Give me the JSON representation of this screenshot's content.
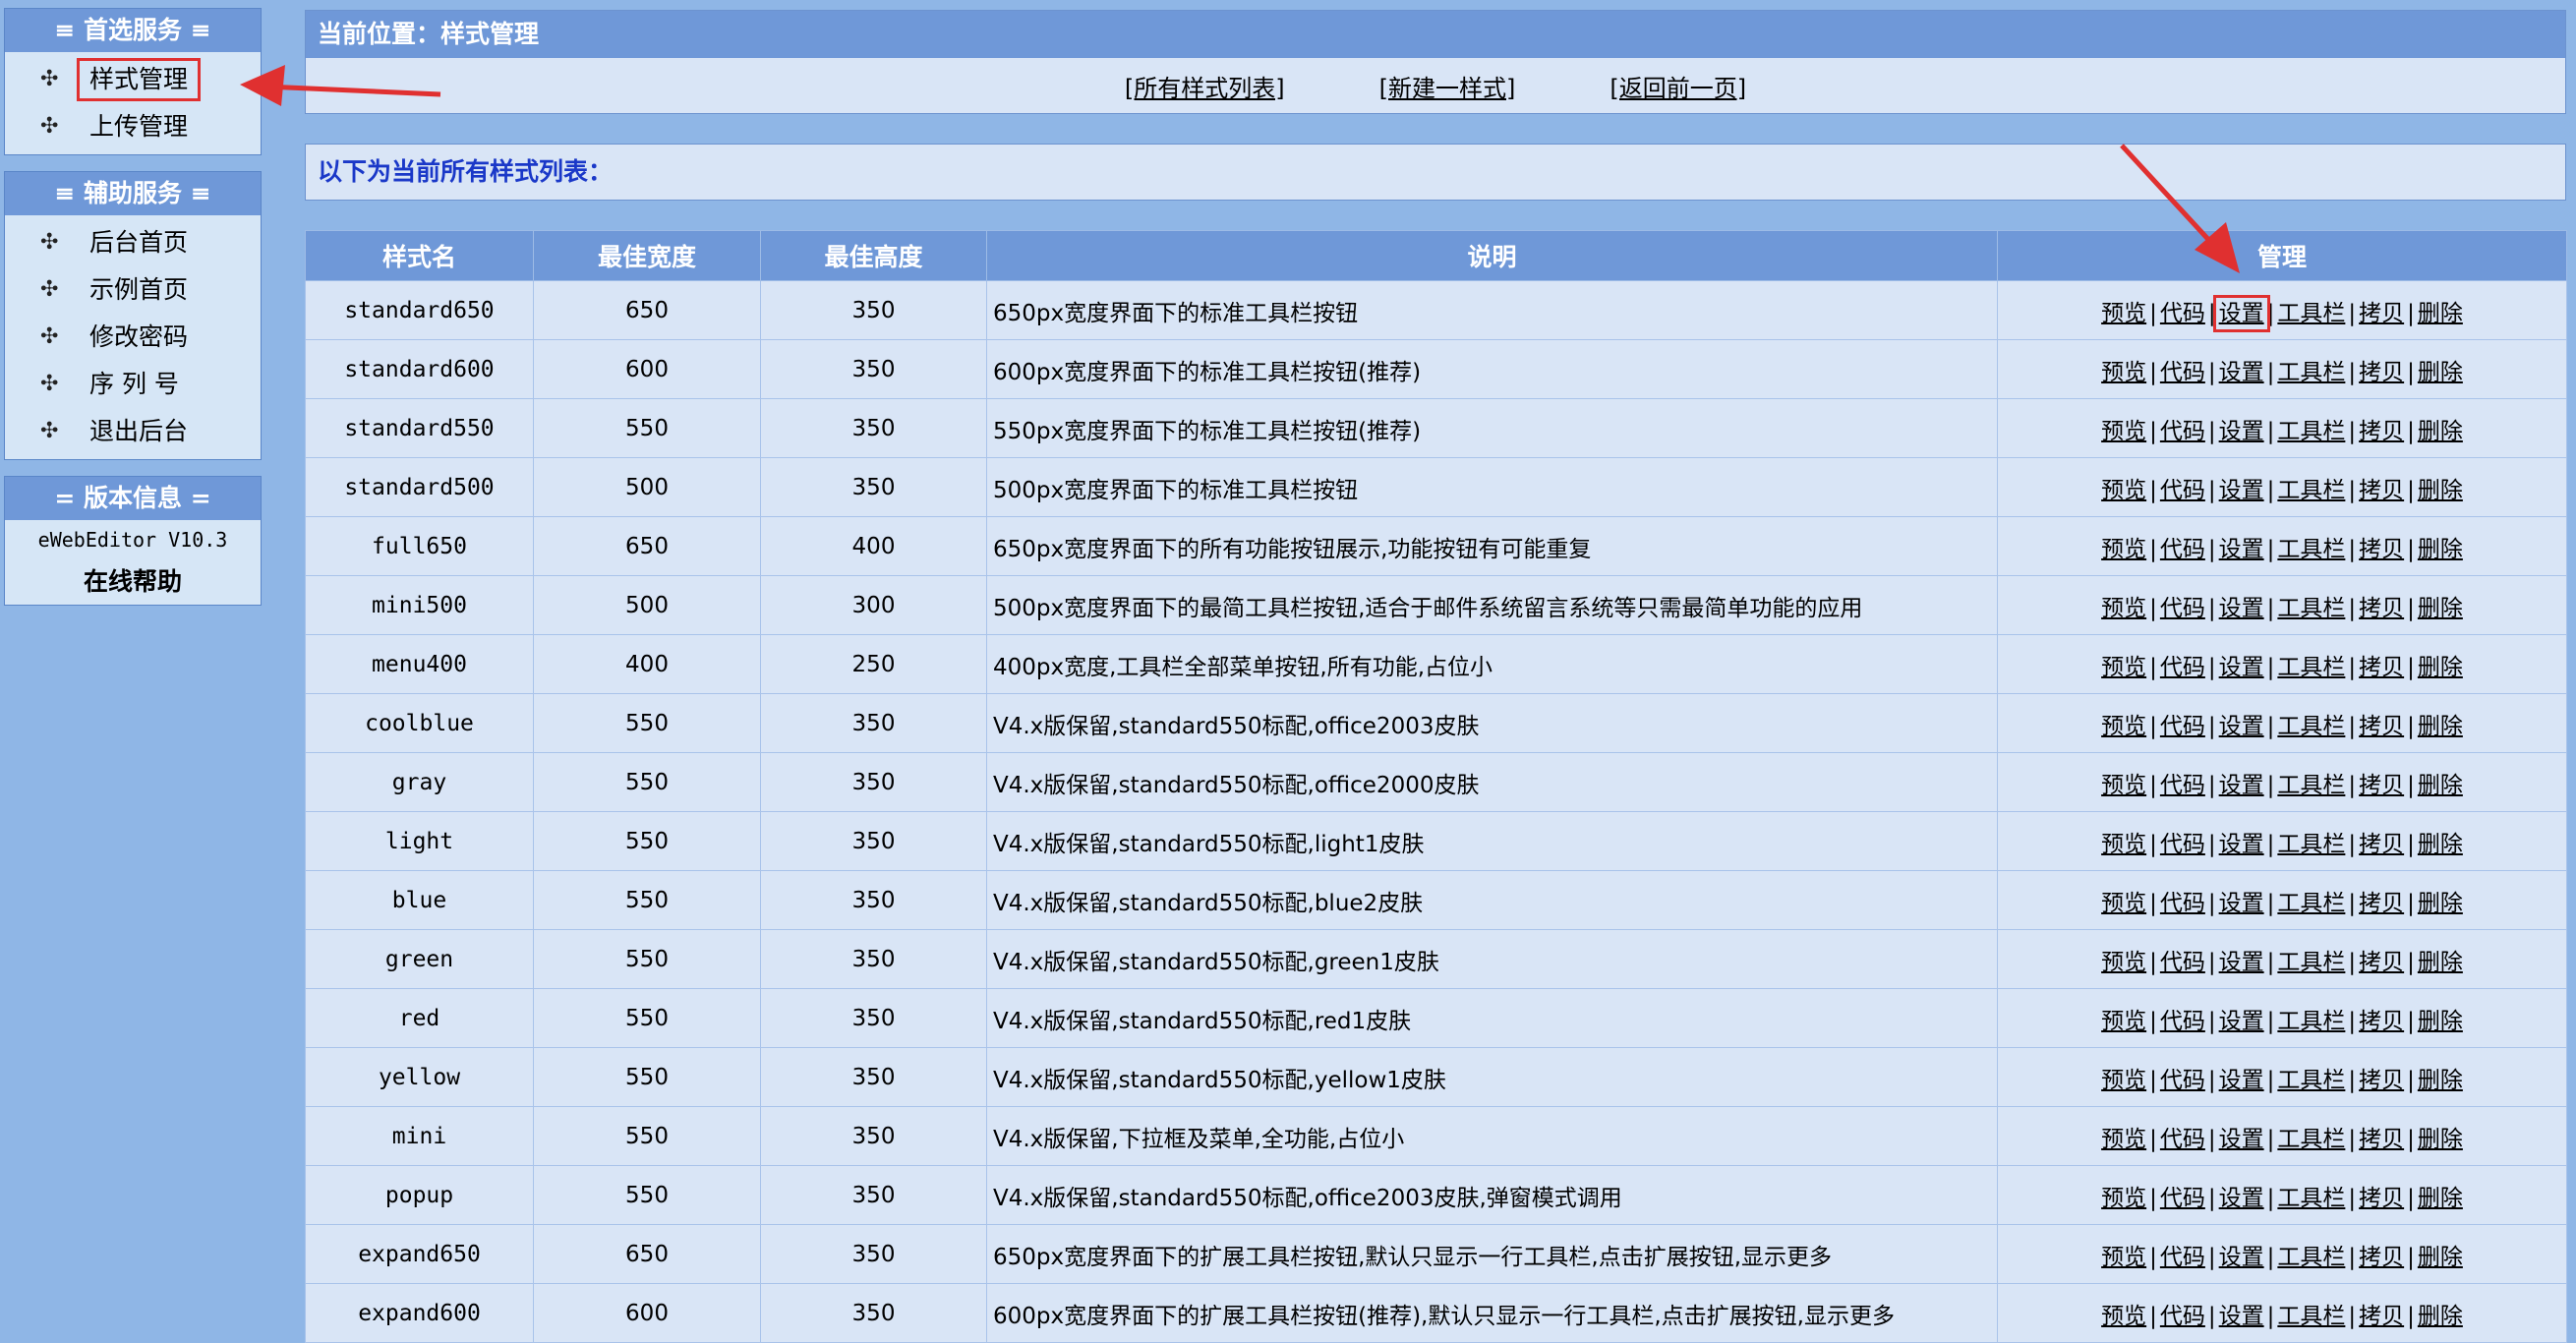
{
  "sidebar": {
    "box1": {
      "title": "≡ 首选服务 ≡",
      "items": [
        {
          "label": "样式管理"
        },
        {
          "label": "上传管理"
        }
      ]
    },
    "box2": {
      "title": "≡ 辅助服务 ≡",
      "items": [
        {
          "label": "后台首页"
        },
        {
          "label": "示例首页"
        },
        {
          "label": "修改密码"
        },
        {
          "label": "序 列 号"
        },
        {
          "label": "退出后台"
        }
      ]
    },
    "box3": {
      "title": "= 版本信息 =",
      "version": "eWebEditor V10.3",
      "help": "在线帮助"
    },
    "bullet": "✣"
  },
  "main": {
    "location": "当前位置：样式管理",
    "toolbar": {
      "all_styles": "[所有样式列表]",
      "new_style": "[新建一样式]",
      "back": "[返回前一页]"
    },
    "list_heading": "以下为当前所有样式列表："
  },
  "table": {
    "headers": [
      "样式名",
      "最佳宽度",
      "最佳高度",
      "说明",
      "管理"
    ],
    "ops": [
      "预览",
      "代码",
      "设置",
      "工具栏",
      "拷贝",
      "删除"
    ],
    "rows": [
      {
        "name": "standard650",
        "width": "650",
        "height": "350",
        "desc": "650px宽度界面下的标准工具栏按钮"
      },
      {
        "name": "standard600",
        "width": "600",
        "height": "350",
        "desc": "600px宽度界面下的标准工具栏按钮(推荐)"
      },
      {
        "name": "standard550",
        "width": "550",
        "height": "350",
        "desc": "550px宽度界面下的标准工具栏按钮(推荐)"
      },
      {
        "name": "standard500",
        "width": "500",
        "height": "350",
        "desc": "500px宽度界面下的标准工具栏按钮"
      },
      {
        "name": "full650",
        "width": "650",
        "height": "400",
        "desc": "650px宽度界面下的所有功能按钮展示,功能按钮有可能重复"
      },
      {
        "name": "mini500",
        "width": "500",
        "height": "300",
        "desc": "500px宽度界面下的最简工具栏按钮,适合于邮件系统留言系统等只需最简单功能的应用"
      },
      {
        "name": "menu400",
        "width": "400",
        "height": "250",
        "desc": "400px宽度,工具栏全部菜单按钮,所有功能,占位小"
      },
      {
        "name": "coolblue",
        "width": "550",
        "height": "350",
        "desc": "V4.x版保留,standard550标配,office2003皮肤"
      },
      {
        "name": "gray",
        "width": "550",
        "height": "350",
        "desc": "V4.x版保留,standard550标配,office2000皮肤"
      },
      {
        "name": "light",
        "width": "550",
        "height": "350",
        "desc": "V4.x版保留,standard550标配,light1皮肤"
      },
      {
        "name": "blue",
        "width": "550",
        "height": "350",
        "desc": "V4.x版保留,standard550标配,blue2皮肤"
      },
      {
        "name": "green",
        "width": "550",
        "height": "350",
        "desc": "V4.x版保留,standard550标配,green1皮肤"
      },
      {
        "name": "red",
        "width": "550",
        "height": "350",
        "desc": "V4.x版保留,standard550标配,red1皮肤"
      },
      {
        "name": "yellow",
        "width": "550",
        "height": "350",
        "desc": "V4.x版保留,standard550标配,yellow1皮肤"
      },
      {
        "name": "mini",
        "width": "550",
        "height": "350",
        "desc": "V4.x版保留,下拉框及菜单,全功能,占位小"
      },
      {
        "name": "popup",
        "width": "550",
        "height": "350",
        "desc": "V4.x版保留,standard550标配,office2003皮肤,弹窗模式调用"
      },
      {
        "name": "expand650",
        "width": "650",
        "height": "350",
        "desc": "650px宽度界面下的扩展工具栏按钮,默认只显示一行工具栏,点击扩展按钮,显示更多"
      },
      {
        "name": "expand600",
        "width": "600",
        "height": "350",
        "desc": "600px宽度界面下的扩展工具栏按钮(推荐),默认只显示一行工具栏,点击扩展按钮,显示更多"
      }
    ]
  },
  "colors": {
    "page_bg": "#8fb6e6",
    "header_bg": "#6f98d8",
    "panel_bg": "#d9e5f6",
    "highlight": "#e03030",
    "list_heading": "#1a38c8"
  }
}
